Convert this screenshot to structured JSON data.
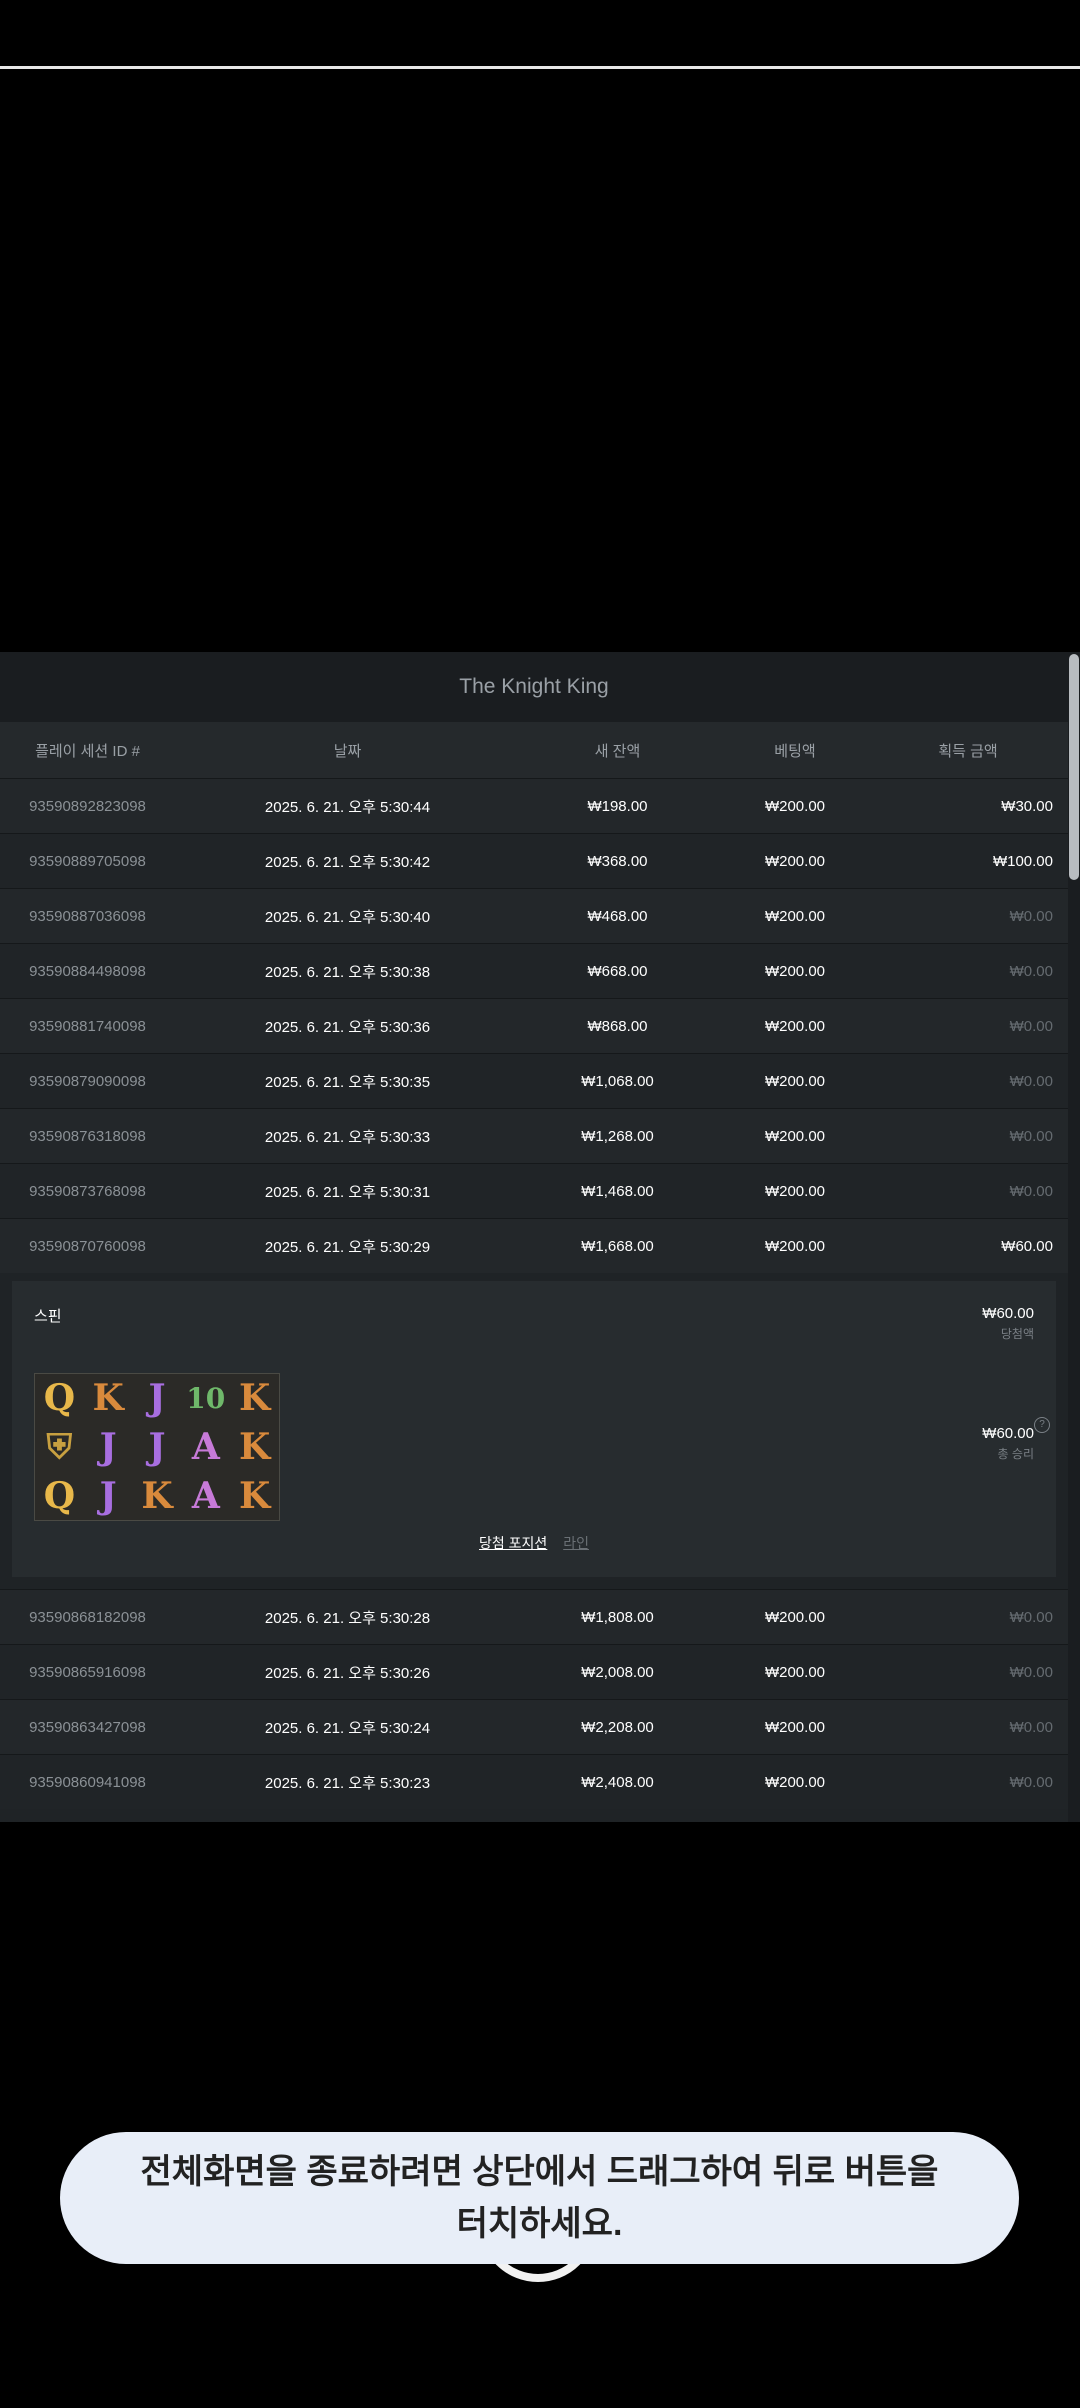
{
  "title": "The Knight King",
  "headers": [
    "플레이 세션 ID #",
    "날짜",
    "새 잔액",
    "베팅액",
    "획득 금액"
  ],
  "rows_before": [
    {
      "id": "93590892823098",
      "date": "2025. 6. 21. 오후 5:30:44",
      "balance": "₩198.00",
      "bet": "₩200.00",
      "win": "₩30.00",
      "zero": false
    },
    {
      "id": "93590889705098",
      "date": "2025. 6. 21. 오후 5:30:42",
      "balance": "₩368.00",
      "bet": "₩200.00",
      "win": "₩100.00",
      "zero": false
    },
    {
      "id": "93590887036098",
      "date": "2025. 6. 21. 오후 5:30:40",
      "balance": "₩468.00",
      "bet": "₩200.00",
      "win": "₩0.00",
      "zero": true
    },
    {
      "id": "93590884498098",
      "date": "2025. 6. 21. 오후 5:30:38",
      "balance": "₩668.00",
      "bet": "₩200.00",
      "win": "₩0.00",
      "zero": true
    },
    {
      "id": "93590881740098",
      "date": "2025. 6. 21. 오후 5:30:36",
      "balance": "₩868.00",
      "bet": "₩200.00",
      "win": "₩0.00",
      "zero": true
    },
    {
      "id": "93590879090098",
      "date": "2025. 6. 21. 오후 5:30:35",
      "balance": "₩1,068.00",
      "bet": "₩200.00",
      "win": "₩0.00",
      "zero": true
    },
    {
      "id": "93590876318098",
      "date": "2025. 6. 21. 오후 5:30:33",
      "balance": "₩1,268.00",
      "bet": "₩200.00",
      "win": "₩0.00",
      "zero": true
    },
    {
      "id": "93590873768098",
      "date": "2025. 6. 21. 오후 5:30:31",
      "balance": "₩1,468.00",
      "bet": "₩200.00",
      "win": "₩0.00",
      "zero": true
    },
    {
      "id": "93590870760098",
      "date": "2025. 6. 21. 오후 5:30:29",
      "balance": "₩1,668.00",
      "bet": "₩200.00",
      "win": "₩60.00",
      "zero": false
    }
  ],
  "detail": {
    "spin_label": "스핀",
    "win_amount": "₩60.00",
    "win_label": "당첨액",
    "total_amount": "₩60.00",
    "total_label": "총 승리",
    "help": "?",
    "symbols": [
      [
        "Q",
        "K",
        "J",
        "10",
        "K"
      ],
      [
        "crest",
        "J",
        "J",
        "A",
        "K"
      ],
      [
        "Q",
        "J",
        "K",
        "A",
        "K"
      ]
    ],
    "tab_active": "당첨 포지션",
    "tab_inactive": "라인"
  },
  "rows_after": [
    {
      "id": "93590868182098",
      "date": "2025. 6. 21. 오후 5:30:28",
      "balance": "₩1,808.00",
      "bet": "₩200.00",
      "win": "₩0.00",
      "zero": true
    },
    {
      "id": "93590865916098",
      "date": "2025. 6. 21. 오후 5:30:26",
      "balance": "₩2,008.00",
      "bet": "₩200.00",
      "win": "₩0.00",
      "zero": true
    },
    {
      "id": "93590863427098",
      "date": "2025. 6. 21. 오후 5:30:24",
      "balance": "₩2,208.00",
      "bet": "₩200.00",
      "win": "₩0.00",
      "zero": true
    },
    {
      "id": "93590860941098",
      "date": "2025. 6. 21. 오후 5:30:23",
      "balance": "₩2,408.00",
      "bet": "₩200.00",
      "win": "₩0.00",
      "zero": true
    }
  ],
  "toast": {
    "line1": "전체화면을 종료하려면 상단에서 드래그하여 뒤로 버튼을",
    "line2": "터치하세요."
  }
}
